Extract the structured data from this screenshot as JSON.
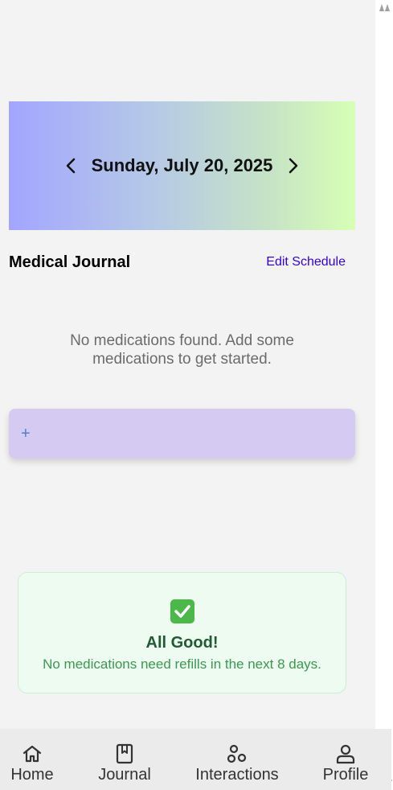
{
  "date_header": {
    "date_label": "Sunday, July 20, 2025",
    "prev_icon": "chevron-left-icon",
    "next_icon": "chevron-right-icon"
  },
  "journal": {
    "title": "Medical Journal",
    "edit_label": "Edit Schedule",
    "empty_message": "No medications found. Add some medications to get started.",
    "add_label": "+"
  },
  "refill_status": {
    "icon": "check-mark-icon",
    "title": "All Good!",
    "message": "No medications need refills in the next 8 days."
  },
  "bottom_nav": {
    "items": [
      {
        "label": "Home",
        "icon": "home-icon"
      },
      {
        "label": "Journal",
        "icon": "bookmark-icon"
      },
      {
        "label": "Interactions",
        "icon": "interactions-icon"
      },
      {
        "label": "Profile",
        "icon": "user-icon"
      }
    ]
  },
  "colors": {
    "banner_start": "#a3a5ff",
    "banner_end": "#d7ffb4",
    "link": "#3300e6",
    "add_card": "#d5caf2",
    "status_bg": "#eefbf1",
    "status_title": "#1f5c33",
    "status_text": "#3a9a4f"
  }
}
